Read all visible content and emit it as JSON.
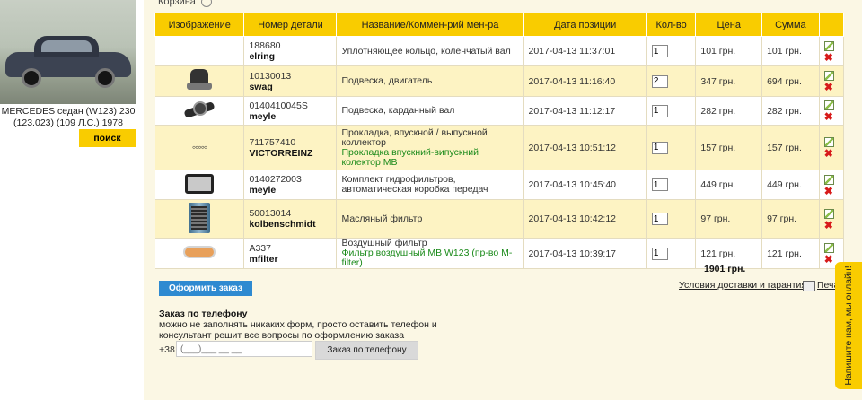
{
  "sidebar": {
    "car_caption": "MERCEDES седан (W123) 230 (123.023) (109 Л.С.) 1978",
    "search_label": "поиск"
  },
  "breadcrumb": "Корзина",
  "table": {
    "headers": [
      "Изображение",
      "Номер детали",
      "Название/Коммен-рий мен-ра",
      "Дата позиции",
      "Кол-во",
      "Цена",
      "Сумма"
    ],
    "rows": [
      {
        "part_no": "188680",
        "brand": "elring",
        "name": "Уплотняющее кольцо, коленчатый вал",
        "comment": "",
        "date": "2017-04-13 11:37:01",
        "qty": "1",
        "price": "101 грн.",
        "sum": "101 грн.",
        "image": "none"
      },
      {
        "part_no": "10130013",
        "brand": "swag",
        "name": "Подвеска, двигатель",
        "comment": "",
        "date": "2017-04-13 11:16:40",
        "qty": "2",
        "price": "347 грн.",
        "sum": "694 грн.",
        "image": "engine-mount"
      },
      {
        "part_no": "0140410045S",
        "brand": "meyle",
        "name": "Подвеска, карданный вал",
        "comment": "",
        "date": "2017-04-13 11:12:17",
        "qty": "1",
        "price": "282 грн.",
        "sum": "282 грн.",
        "image": "shaft-bearing"
      },
      {
        "part_no": "711757410",
        "brand": "VICTORREINZ",
        "name": "Прокладка, впускной / выпускной коллектор",
        "comment": "Прокладка впускний-випускний колектор MB",
        "date": "2017-04-13 10:51:12",
        "qty": "1",
        "price": "157 грн.",
        "sum": "157 грн.",
        "image": "gasket"
      },
      {
        "part_no": "0140272003",
        "brand": "meyle",
        "name": "Комплект гидрофильтров, автоматическая коробка передач",
        "comment": "",
        "date": "2017-04-13 10:45:40",
        "qty": "1",
        "price": "449 грн.",
        "sum": "449 грн.",
        "image": "filter-kit"
      },
      {
        "part_no": "50013014",
        "brand": "kolbenschmidt",
        "name": "Масляный фильтр",
        "comment": "",
        "date": "2017-04-13 10:42:12",
        "qty": "1",
        "price": "97 грн.",
        "sum": "97 грн.",
        "image": "oil-filter"
      },
      {
        "part_no": "A337",
        "brand": "mfilter",
        "name": "Воздушный фильтр",
        "comment": "Фильтр воздушный MB W123 (пр-во M-filter)",
        "date": "2017-04-13 10:39:17",
        "qty": "1",
        "price": "121 грн.",
        "sum": "121 грн.",
        "image": "air-filter"
      }
    ],
    "total": "1901 грн."
  },
  "order_button": "Оформить заказ",
  "delivery_link": "Условия доставки и гарантия",
  "print_link": "Печа",
  "phone_order": {
    "title": "Заказ по телефону",
    "description": "можно не заполнять никаких форм, просто оставить телефон и консультант решит все вопросы по оформлению заказа",
    "prefix": "+38",
    "placeholder": "(___)___ __ __",
    "button": "Заказ по телефону"
  },
  "chat_label": "Напишите нам, мы онлайн!",
  "colors": {
    "accent": "#f9cc00",
    "button_blue": "#2e8ad1",
    "comment_green": "#1a8a1a",
    "delete_red": "#d71a1a",
    "page_bg": "#fbf7e4"
  }
}
